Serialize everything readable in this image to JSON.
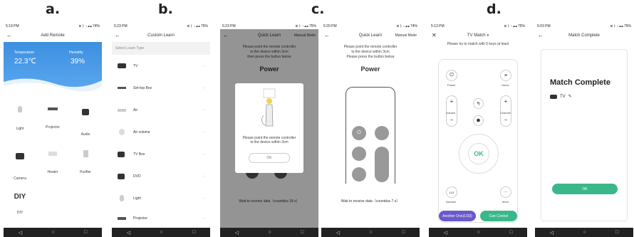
{
  "labels": [
    "a.",
    "b.",
    "c.",
    "d."
  ],
  "nav": {
    "back": "◁",
    "home": "○",
    "recent": "□"
  },
  "p1": {
    "status_time": "5:19 PM",
    "status_right": "⊠ ᛒ ▾◢◢ 74%",
    "title": "Add Remote",
    "temp_label": "Temperature",
    "temp": "22.3℃",
    "hum_label": "Humidity",
    "hum": "39%",
    "items": [
      "Light",
      "Projector",
      "Audio",
      "Camera",
      "Heater",
      "Purifier"
    ],
    "diy_big": "DIY",
    "diy": "DIY"
  },
  "p2": {
    "status_time": "5:23 PM",
    "status_right": "⊠ ᛒ ▾◢◢ 75%",
    "title": "Custom Learn",
    "select": "Select Learn Type",
    "items": [
      "TV",
      "Set-top Box",
      "Air",
      "Air volume",
      "TV Box",
      "DVD",
      "Light",
      "Projector"
    ]
  },
  "p3": {
    "status_time": "5:23 PM",
    "status_right": "⊠ ᛒ ▾◢◢ 75%",
    "title": "Quick Learn",
    "manual": "Manual Mode",
    "line1": "Please point the remote controller",
    "line2": "to the device within 3cm",
    "line3": "then press the button below",
    "key": "Power",
    "dlg1": "Please point the remote controller",
    "dlg2": "to the device within 3cm",
    "ok": "OK",
    "wait": "Wait to receive data（countdus 18 s）"
  },
  "p4": {
    "status_time": "5:20 PM",
    "status_right": "⊠ ᛒ ▾◢◢ 74%",
    "title": "Quick Learn",
    "manual": "Manual Mode",
    "line1": "Please point the remote controller",
    "line2": "to the device within 3cm",
    "line3": "Please press the button below",
    "key": "Power",
    "wait": "Wait to receive data（countdus 7 s）"
  },
  "p5": {
    "status_time": "5:13 PM",
    "status_right": "⊠ ᛒ ▾◢◢ 75%",
    "title": "TV Match",
    "hint": "Please try to match with 5 keys at least",
    "power": "Power",
    "home": "Home",
    "vol": "Volume",
    "ch": "Channel",
    "ok": "OK",
    "num": "Number",
    "num_icon": "123",
    "more": "More",
    "more_icon": "···",
    "another": "Another One(1/33)",
    "can": "Can Control"
  },
  "p6": {
    "status_time": "5:03 PM",
    "status_right": "⊠ ᛒ ▾◢◢ 75%",
    "title": "Match Complete",
    "heading": "Match Complete",
    "tv": "TV",
    "ok": "OK"
  },
  "colors": {
    "accent": "#3ab88a",
    "blue": "#3a8ee0",
    "purple": "#6a5acd"
  }
}
